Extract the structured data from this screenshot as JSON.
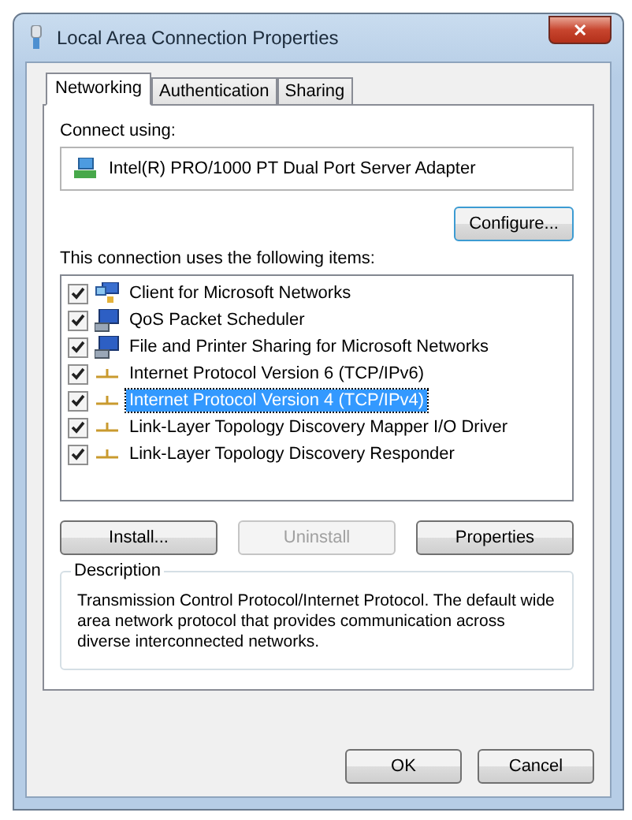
{
  "window": {
    "title": "Local Area Connection Properties",
    "close": "✕"
  },
  "tabs": [
    {
      "label": "Networking",
      "selected": true
    },
    {
      "label": "Authentication",
      "selected": false
    },
    {
      "label": "Sharing",
      "selected": false
    }
  ],
  "connect_using": {
    "label": "Connect using:",
    "adapter": "Intel(R) PRO/1000 PT Dual Port Server Adapter",
    "configure": "Configure..."
  },
  "items_label": "This connection uses the following items:",
  "items": [
    {
      "kind": "client",
      "label": "Client for Microsoft Networks",
      "checked": true,
      "selected": false
    },
    {
      "kind": "service",
      "label": "QoS Packet Scheduler",
      "checked": true,
      "selected": false
    },
    {
      "kind": "service",
      "label": "File and Printer Sharing for Microsoft Networks",
      "checked": true,
      "selected": false
    },
    {
      "kind": "protocol",
      "label": "Internet Protocol Version 6 (TCP/IPv6)",
      "checked": true,
      "selected": false
    },
    {
      "kind": "protocol",
      "label": "Internet Protocol Version 4 (TCP/IPv4)",
      "checked": true,
      "selected": true
    },
    {
      "kind": "protocol",
      "label": "Link-Layer Topology Discovery Mapper I/O Driver",
      "checked": true,
      "selected": false
    },
    {
      "kind": "protocol",
      "label": "Link-Layer Topology Discovery Responder",
      "checked": true,
      "selected": false
    }
  ],
  "item_buttons": [
    {
      "label": "Install...",
      "disabled": false
    },
    {
      "label": "Uninstall",
      "disabled": true
    },
    {
      "label": "Properties",
      "disabled": false
    }
  ],
  "description": {
    "title": "Description",
    "text": "Transmission Control Protocol/Internet Protocol. The default wide area network protocol that provides communication across diverse interconnected networks."
  },
  "buttons": [
    "OK",
    "Cancel"
  ]
}
